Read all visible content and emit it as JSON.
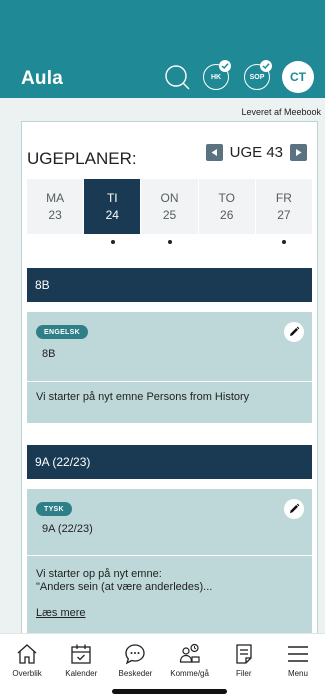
{
  "header": {
    "logo": "Aula",
    "badges": [
      {
        "label": "HK",
        "checked": true
      },
      {
        "label": "SOP",
        "checked": true
      }
    ],
    "avatar_initials": "CT",
    "color": "#1f8a96"
  },
  "provider_text": "Leveret af Meebook",
  "weekplan": {
    "title": "UGEPLANER:",
    "week_label": "UGE 43",
    "days": [
      {
        "name": "MA",
        "date": "23",
        "active": false,
        "has_entry": false
      },
      {
        "name": "TI",
        "date": "24",
        "active": true,
        "has_entry": true
      },
      {
        "name": "ON",
        "date": "25",
        "active": false,
        "has_entry": true
      },
      {
        "name": "TO",
        "date": "26",
        "active": false,
        "has_entry": false
      },
      {
        "name": "FR",
        "date": "27",
        "active": false,
        "has_entry": true
      }
    ],
    "active_color": "#193a52"
  },
  "classes": [
    {
      "header": "8B",
      "subject": "ENGELSK",
      "class_name": "8B",
      "text": "Vi starter på nyt emne Persons from History"
    },
    {
      "header": "9A (22/23)",
      "subject": "TYSK",
      "class_name": "9A (22/23)",
      "text_line1": "Vi starter op på nyt emne:",
      "text_line2": "\"Anders sein (at være anderledes)...",
      "link": "Læs mere"
    }
  ],
  "bottom_nav": [
    {
      "label": "Overblik",
      "icon": "home-icon"
    },
    {
      "label": "Kalender",
      "icon": "calendar-icon"
    },
    {
      "label": "Beskeder",
      "icon": "chat-bubble-icon"
    },
    {
      "label": "Komme/gå",
      "icon": "people-clock-icon"
    },
    {
      "label": "Filer",
      "icon": "document-icon"
    },
    {
      "label": "Menu",
      "icon": "hamburger-menu-icon"
    }
  ],
  "card_color": "#bed8d9"
}
